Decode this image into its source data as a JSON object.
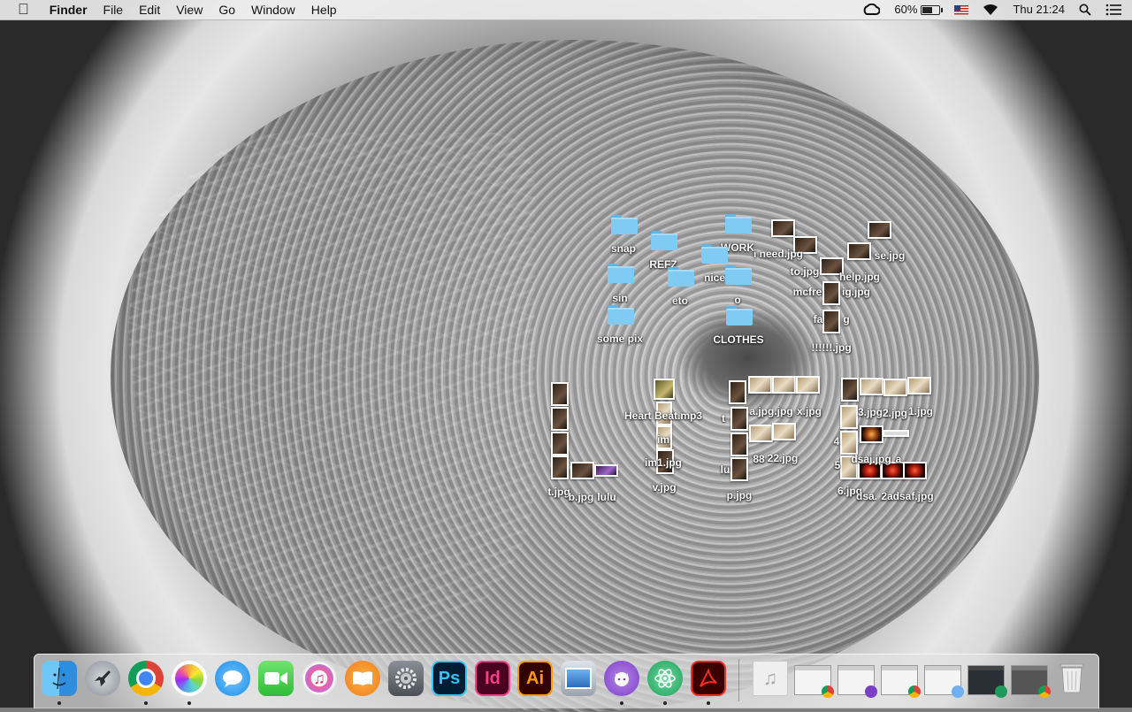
{
  "menubar": {
    "apple_icon": "apple-logo-icon",
    "app_name": "Finder",
    "menus": [
      "File",
      "Edit",
      "View",
      "Go",
      "Window",
      "Help"
    ],
    "status": {
      "battery_percent": "60%",
      "battery_level": 0.6,
      "clock": "Thu 21:24"
    }
  },
  "desktop": {
    "folders": [
      {
        "label": "snap"
      },
      {
        "label": "REFZ"
      },
      {
        "label": "WORK"
      },
      {
        "label": "sin"
      },
      {
        "label": "eto"
      },
      {
        "label": "nice"
      },
      {
        "label": "o"
      },
      {
        "label": "some pix"
      },
      {
        "label": "CLOTHES"
      }
    ],
    "file_labels": {
      "i_need": "i need.jpg",
      "se": "se.jpg",
      "to": "to.jpg",
      "help": "help.jpg",
      "mcfre": "mcfre",
      "ig": "ig.jpg",
      "fa": "fa",
      "g": "g",
      "bang": "!!!!!!.jpg",
      "heart": "Heart Beat.mp3",
      "im": "im",
      "im1": "im1.jpg",
      "v": "v.jpg",
      "t_jpg": "t.jpg",
      "b_jpg": "b.jpg",
      "lulu": "lulu",
      "a_jpg": "a.jpg.jpg",
      "x_jpg": "x.jpg",
      "tl": "t",
      "88": "88",
      "22": "22.jpg",
      "lu": "lu",
      "p_jpg": "p.jpg",
      "3_jpg": "3.jpg",
      "2_jpg": "2.jpg",
      "1_jpg": "1.jpg",
      "4": "4",
      "dsaj": "dsaj.jpg",
      "a": "a",
      "5": "5",
      "6_jpg": "6.jpg",
      "dsa": "dsa.",
      "2adsaf": "2adsaf.jpg"
    }
  },
  "dock": {
    "apps": [
      {
        "name": "Finder",
        "icon": "finder-icon"
      },
      {
        "name": "Launchpad",
        "icon": "rocket-icon"
      },
      {
        "name": "Chrome",
        "icon": "chrome-icon"
      },
      {
        "name": "Photos",
        "icon": "photos-icon"
      },
      {
        "name": "Messages",
        "icon": "messages-icon"
      },
      {
        "name": "FaceTime",
        "icon": "facetime-icon"
      },
      {
        "name": "iTunes",
        "icon": "itunes-icon"
      },
      {
        "name": "iBooks",
        "icon": "ibooks-icon"
      },
      {
        "name": "System Preferences",
        "icon": "gear-icon"
      },
      {
        "name": "Photoshop",
        "icon": "photoshop-icon",
        "text": "Ps"
      },
      {
        "name": "InDesign",
        "icon": "indesign-icon",
        "text": "Id"
      },
      {
        "name": "Illustrator",
        "icon": "illustrator-icon",
        "text": "Ai"
      },
      {
        "name": "Preview",
        "icon": "preview-icon"
      },
      {
        "name": "GitHub",
        "icon": "github-icon"
      },
      {
        "name": "Atom",
        "icon": "atom-icon"
      },
      {
        "name": "Acrobat",
        "icon": "acrobat-icon"
      }
    ],
    "colors": {
      "photoshop": "#001d34",
      "photoshop_text": "#31c5f0",
      "indesign": "#49021f",
      "indesign_text": "#ff3d8b",
      "illustrator": "#330000",
      "illustrator_text": "#ff9a00"
    }
  }
}
